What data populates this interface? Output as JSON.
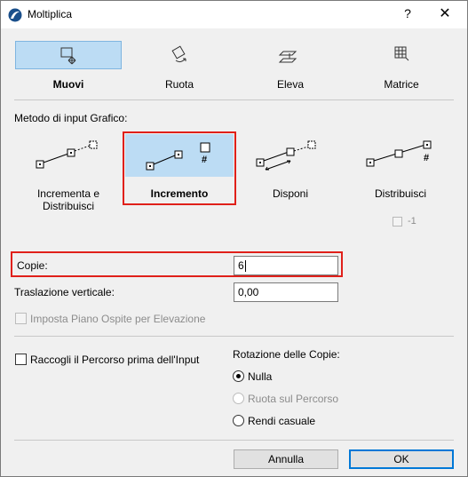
{
  "window": {
    "title": "Moltiplica",
    "help": "?",
    "close": "✕"
  },
  "tabs": [
    {
      "label": "Muovi",
      "icon": "move-icon",
      "active": true
    },
    {
      "label": "Ruota",
      "icon": "rotate-icon",
      "active": false
    },
    {
      "label": "Eleva",
      "icon": "elevate-icon",
      "active": false
    },
    {
      "label": "Matrice",
      "icon": "matrix-icon",
      "active": false
    }
  ],
  "methods": {
    "section_label": "Metodo di input Grafico:",
    "items": [
      {
        "label_line1": "Incrementa e",
        "label_line2": "Distribuisci",
        "icon": "increment-distribute-icon",
        "selected": false
      },
      {
        "label_line1": "Incremento",
        "label_line2": "",
        "icon": "increment-icon",
        "selected": true
      },
      {
        "label_line1": "Disponi",
        "label_line2": "",
        "icon": "arrange-icon",
        "selected": false
      },
      {
        "label_line1": "Distribuisci",
        "label_line2": "",
        "icon": "distribute-icon",
        "selected": false
      }
    ],
    "minus_one_label": "-1"
  },
  "fields": {
    "copies_label": "Copie:",
    "copies_value": "6",
    "vertical_label": "Traslazione verticale:",
    "vertical_value": "0,00",
    "host_floor_label": "Imposta Piano Ospite per Elevazione"
  },
  "options": {
    "collect_path_label": "Raccogli il Percorso prima dell'Input",
    "rotation_label": "Rotazione delle Copie:",
    "radios": [
      {
        "label": "Nulla",
        "checked": true,
        "disabled": false
      },
      {
        "label": "Ruota sul Percorso",
        "checked": false,
        "disabled": true
      },
      {
        "label": "Rendi casuale",
        "checked": false,
        "disabled": false
      }
    ]
  },
  "buttons": {
    "cancel": "Annulla",
    "ok": "OK"
  },
  "colors": {
    "selection": "#bcdcf4",
    "highlight": "#e0201a",
    "default_button_border": "#0078d7"
  }
}
